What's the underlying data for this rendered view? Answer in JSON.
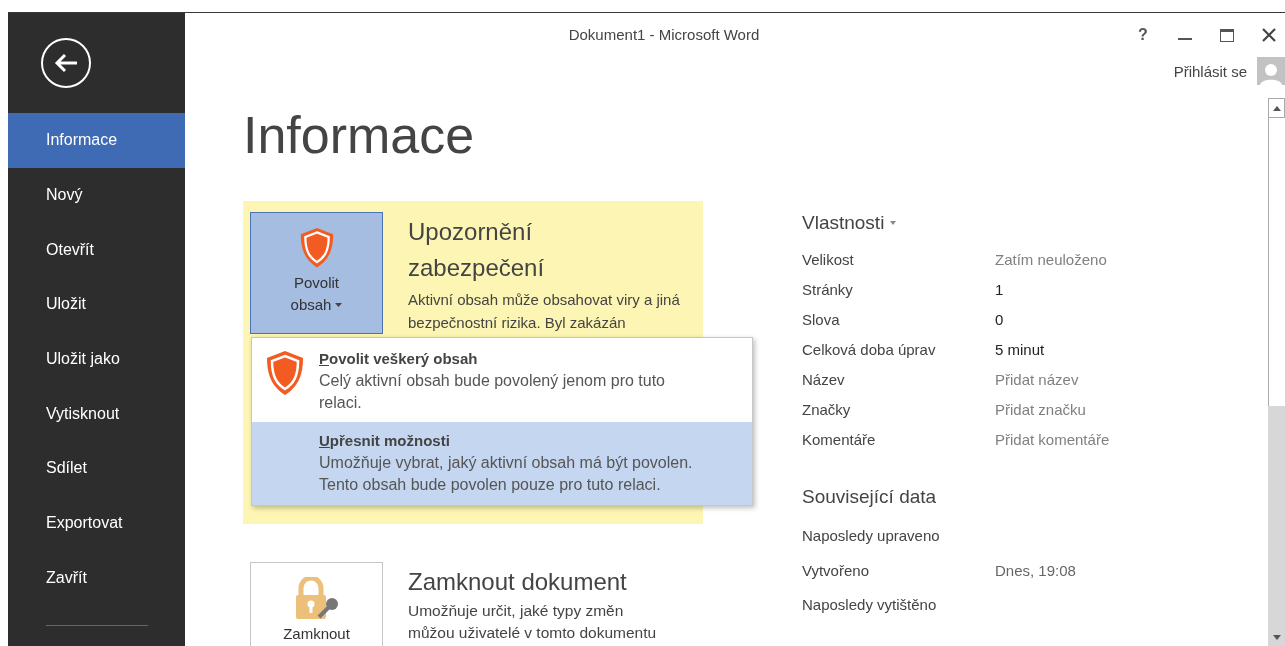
{
  "window": {
    "title": "Dokument1 - Microsoft Word",
    "controls": [
      {
        "kind": "help",
        "label": "?"
      },
      {
        "kind": "minimize"
      },
      {
        "kind": "maximize"
      },
      {
        "kind": "close"
      }
    ],
    "sign_in": "Přihlásit se"
  },
  "sidebar": {
    "items": [
      {
        "label": "Informace",
        "selected": true
      },
      {
        "label": "Nový",
        "selected": false
      },
      {
        "label": "Otevřít",
        "selected": false
      },
      {
        "label": "Uložit",
        "selected": false
      },
      {
        "label": "Uložit jako",
        "selected": false
      },
      {
        "label": "Vytisknout",
        "selected": false
      },
      {
        "label": "Sdílet",
        "selected": false
      },
      {
        "label": "Exportovat",
        "selected": false
      },
      {
        "label": "Zavřít",
        "selected": false
      }
    ]
  },
  "page_title": "Informace",
  "security": {
    "button": {
      "line1": "Povolit",
      "line2": "obsah"
    },
    "heading": "Upozornění zabezpečení",
    "text": "Aktivní obsah může obsahovat viry a jiná bezpečnostní rizika. Byl zakázán",
    "menu": [
      {
        "title": "Povolit veškerý obsah",
        "description": "Celý aktivní obsah bude povolený jenom pro tuto relaci.",
        "kind": "shield",
        "selected": false
      },
      {
        "title": "Upřesnit možnosti",
        "description": "Umožňuje vybrat, jaký aktivní obsah má být povolen. Tento obsah bude povolen pouze pro tuto relaci.",
        "kind": "plain",
        "selected": true
      }
    ]
  },
  "protect": {
    "button": "Zamknout",
    "heading": "Zamknout dokument",
    "text": "Umožňuje určit, jaké typy změn můžou uživatelé v tomto dokumentu"
  },
  "properties": {
    "heading": "Vlastnosti",
    "rows": [
      {
        "label": "Velikost",
        "value": "Zatím neuloženo",
        "dim": true
      },
      {
        "label": "Stránky",
        "value": "1",
        "dim": false
      },
      {
        "label": "Slova",
        "value": "0",
        "dim": false
      },
      {
        "label": "Celková doba úprav",
        "value": "5 minut",
        "dim": false
      },
      {
        "label": "Název",
        "value": "Přidat název",
        "dim": true
      },
      {
        "label": "Značky",
        "value": "Přidat značku",
        "dim": true
      },
      {
        "label": "Komentáře",
        "value": "Přidat komentáře",
        "dim": true
      }
    ]
  },
  "related": {
    "heading": "Související data",
    "rows": [
      {
        "label": "Naposledy upraveno"
      },
      {
        "label": "Vytvořeno",
        "value": "Dnes, 19:08"
      },
      {
        "label": "Naposledy vytištěno"
      }
    ]
  }
}
